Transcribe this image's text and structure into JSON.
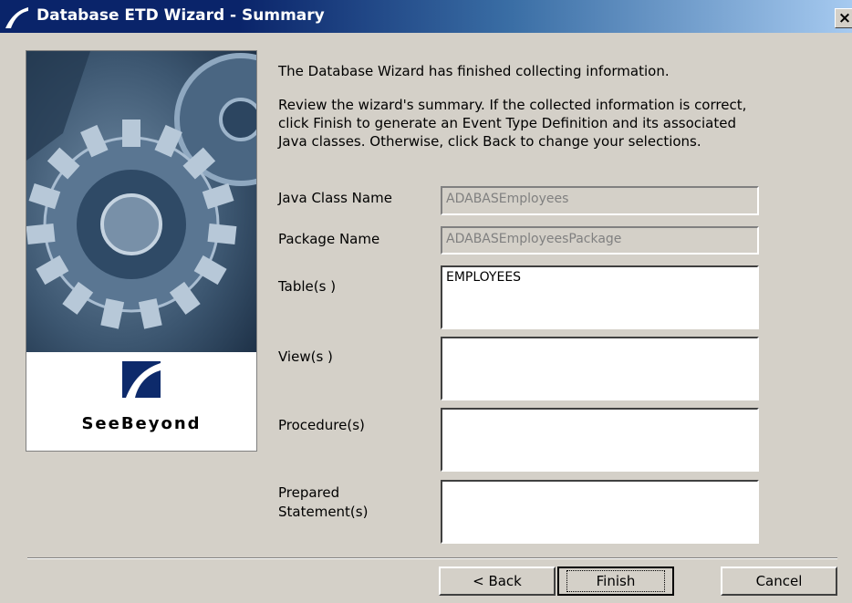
{
  "window": {
    "title": "Database ETD Wizard - Summary",
    "close_label": "×"
  },
  "side_panel": {
    "brand": "SeeBeyond"
  },
  "content": {
    "intro": "The Database Wizard has finished collecting information.",
    "instructions": "Review the wizard's summary.  If the collected information is correct, click Finish to generate an Event Type Definition and its associated Java classes.  Otherwise, click Back to change your selections."
  },
  "fields": {
    "java_class_name": {
      "label": "Java Class Name",
      "value": "ADABASEmployees"
    },
    "package_name": {
      "label": "Package Name",
      "value": "ADABASEmployeesPackage"
    },
    "tables": {
      "label": "Table(s )",
      "value": "EMPLOYEES"
    },
    "views": {
      "label": "View(s )",
      "value": ""
    },
    "procedures": {
      "label": "Procedure(s)",
      "value": ""
    },
    "prepared_statements": {
      "label": "Prepared Statement(s)",
      "value": ""
    }
  },
  "buttons": {
    "back": "< Back",
    "finish": "Finish",
    "cancel": "Cancel"
  },
  "colors": {
    "title_bar_start": "#0a246a",
    "title_bar_end": "#a6caf0",
    "dialog_bg": "#d4d0c8"
  }
}
